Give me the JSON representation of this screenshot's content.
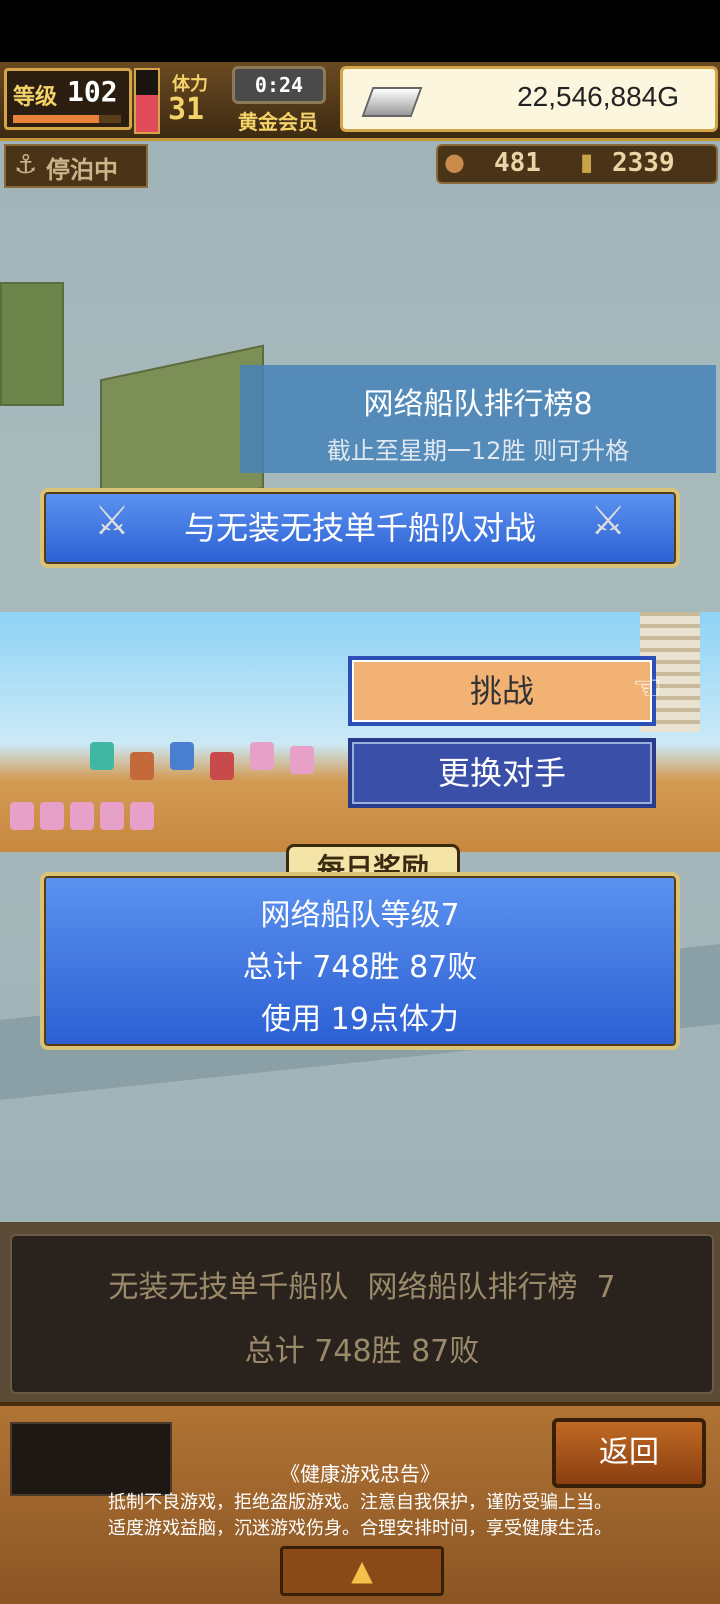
{
  "hud": {
    "level_label": "等级",
    "level_value": "102",
    "stamina_label": "体力",
    "stamina_value": "31",
    "timer": "0:24",
    "member_label": "黄金会员",
    "gold": "22,546,884G",
    "status": "停泊中",
    "resource_a": "481",
    "resource_b": "2339"
  },
  "ranking": {
    "title": "网络船队排行榜8",
    "subtitle": "截止至星期一12胜 则可升格"
  },
  "battle_banner": "与无装无技单千船队对战",
  "actions": {
    "challenge": "挑战",
    "change_opponent": "更换对手"
  },
  "daily_reward": {
    "badge": "每日奖励",
    "line1": "网络船队等级7",
    "line2": "总计 748胜 87败",
    "line3": "使用 19点体力"
  },
  "opponent_info": {
    "line1": "无装无技单千船队  网络船队排行榜  7",
    "line2": "总计 748胜 87败"
  },
  "footer": {
    "back": "返回",
    "health_title": "《健康游戏忠告》",
    "health_line1": "抵制不良游戏，拒绝盗版游戏。注意自我保护，谨防受骗上当。",
    "health_line2": "适度游戏益脑，沉迷游戏伤身。合理安排时间，享受健康生活。"
  },
  "colors": {
    "accent_gold": "#d9c378",
    "button_blue": "#2c5fd3",
    "challenge_orange": "#f2b273",
    "opponent_text": "#9a8a6a"
  }
}
